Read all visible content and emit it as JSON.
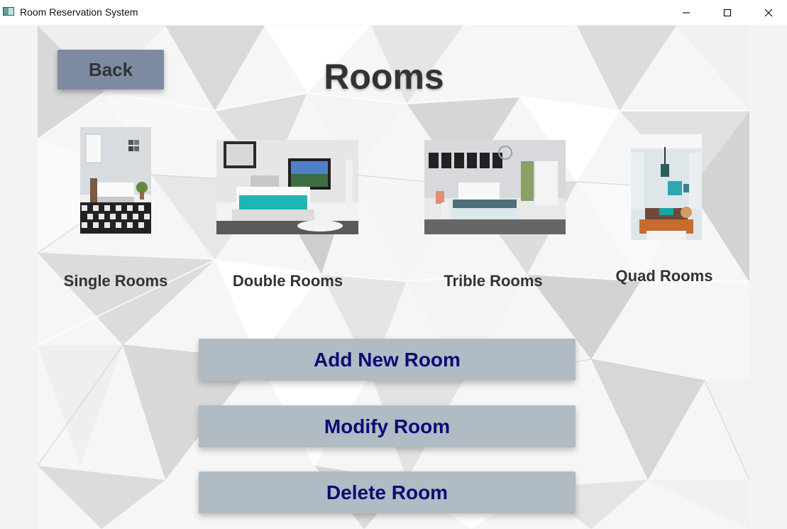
{
  "window": {
    "title": "Room Reservation System",
    "icons": {
      "app": "app-window-icon",
      "minimize": "minimize-icon",
      "maximize": "maximize-icon",
      "close": "close-icon"
    }
  },
  "page": {
    "title": "Rooms",
    "back_label": "Back"
  },
  "rooms": [
    {
      "label": "Single Rooms",
      "image": "single-room-photo"
    },
    {
      "label": "Double Rooms",
      "image": "double-room-photo"
    },
    {
      "label": "Trible Rooms",
      "image": "triple-room-photo"
    },
    {
      "label": "Quad Rooms",
      "image": "quad-room-photo"
    }
  ],
  "actions": {
    "add_label": "Add New Room",
    "modify_label": "Modify Room",
    "delete_label": "Delete Room"
  },
  "colors": {
    "back_button": "#7d8ba2",
    "action_button": "#b0bbc4",
    "action_text": "#0b0b75",
    "title_text": "#333333"
  }
}
